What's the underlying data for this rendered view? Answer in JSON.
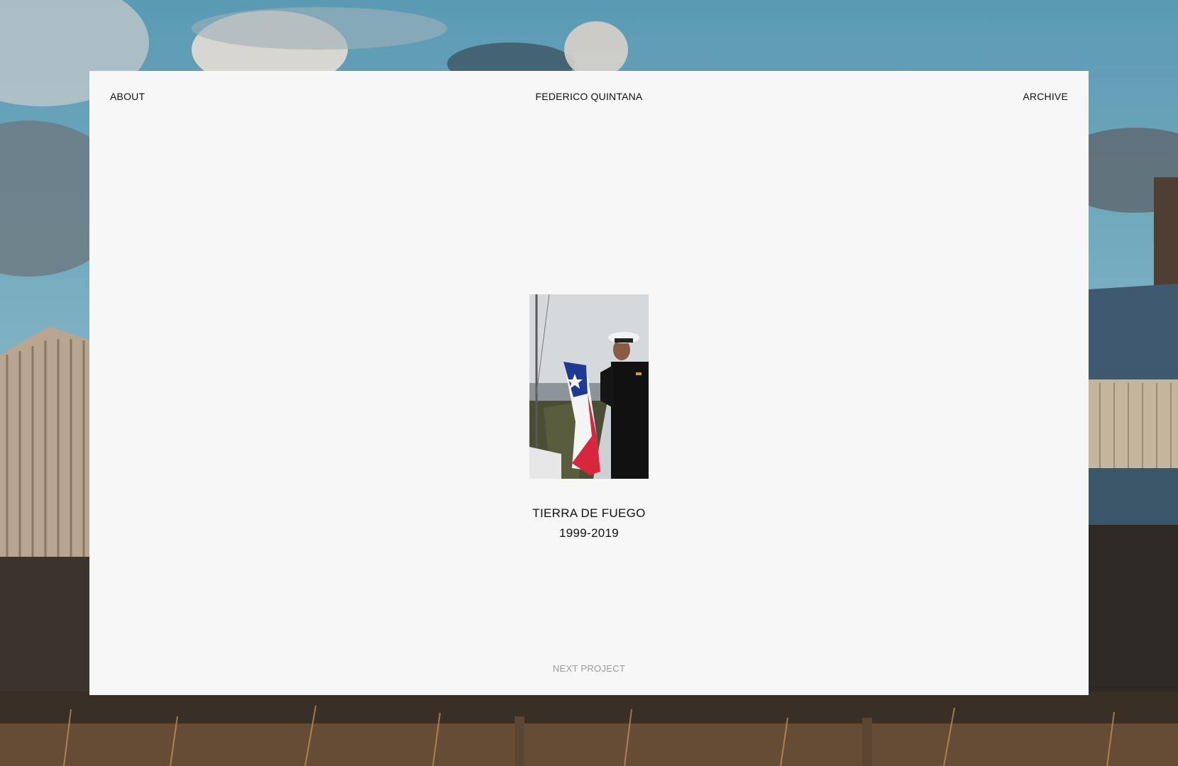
{
  "header": {
    "about_label": "ABOUT",
    "site_title": "FEDERICO QUINTANA",
    "archive_label": "ARCHIVE"
  },
  "project": {
    "title": "TIERRA DE FUEGO",
    "years": "1999-2019",
    "thumbnail_icon": "photo-sailor-with-chilean-flag"
  },
  "footer": {
    "next_label": "NEXT PROJECT"
  },
  "colors": {
    "panel_background": "#f7f7f7",
    "text": "#111111",
    "muted_text": "#9a9a9a",
    "sky": "#5b9ab3"
  }
}
